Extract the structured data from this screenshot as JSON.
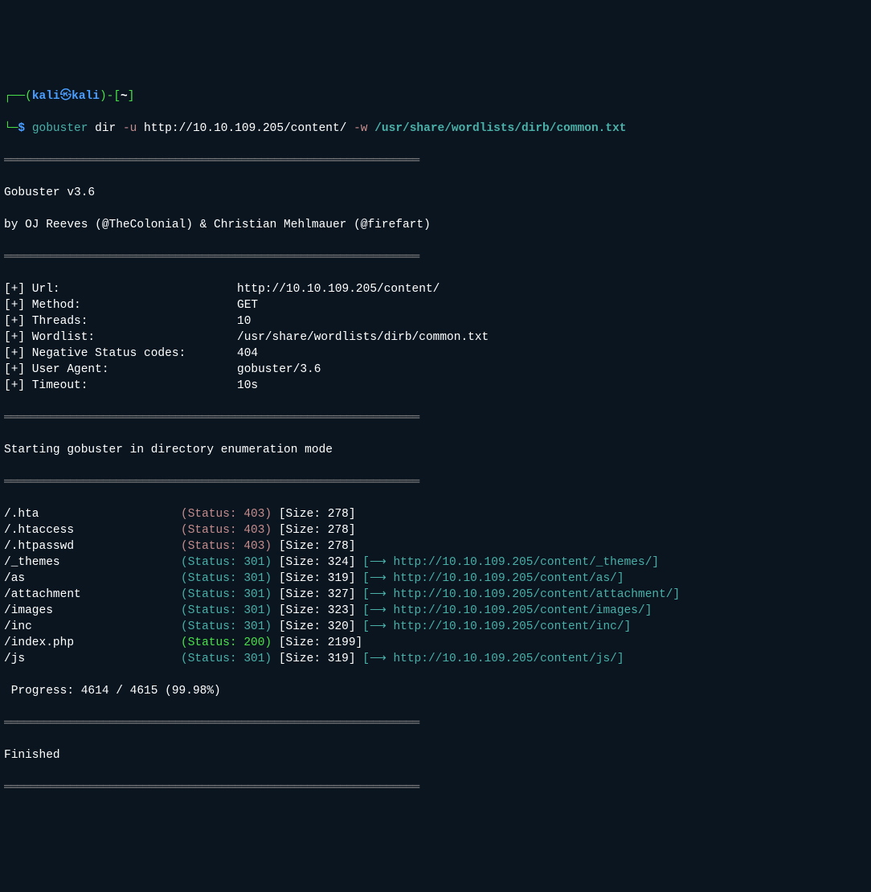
{
  "prompt": {
    "l1_open": "┌──(",
    "user": "kali",
    "skull": "㉿",
    "host": "kali",
    "l1_close": ")-[",
    "tilde": "~",
    "l1_end": "]",
    "l2_open": "└─",
    "dollar": "$ ",
    "cmd": "gobuster",
    "arg1": " dir ",
    "flag1": "-u",
    "url": " http://10.10.109.205/content/ ",
    "flag2": "-w",
    "wordlist": " /usr/share/wordlists/dirb/common.txt"
  },
  "sep": "═══════════════════════════════════════════════════════════════",
  "header": {
    "title": "Gobuster v3.6",
    "byline": "by OJ Reeves (@TheColonial) & Christian Mehlmauer (@firefart)"
  },
  "config": [
    {
      "label": "[+] Url:",
      "value": "http://10.10.109.205/content/"
    },
    {
      "label": "[+] Method:",
      "value": "GET"
    },
    {
      "label": "[+] Threads:",
      "value": "10"
    },
    {
      "label": "[+] Wordlist:",
      "value": "/usr/share/wordlists/dirb/common.txt"
    },
    {
      "label": "[+] Negative Status codes:",
      "value": "404"
    },
    {
      "label": "[+] User Agent:",
      "value": "gobuster/3.6"
    },
    {
      "label": "[+] Timeout:",
      "value": "10s"
    }
  ],
  "mode": "Starting gobuster in directory enumeration mode",
  "results": [
    {
      "path": "/.hta",
      "status": "(Status: 403)",
      "scol": "redgray",
      "size": " [Size: 278]",
      "redirect": ""
    },
    {
      "path": "/.htaccess",
      "status": "(Status: 403)",
      "scol": "redgray",
      "size": " [Size: 278]",
      "redirect": ""
    },
    {
      "path": "/.htpasswd",
      "status": "(Status: 403)",
      "scol": "redgray",
      "size": " [Size: 278]",
      "redirect": ""
    },
    {
      "path": "/_themes",
      "status": "(Status: 301)",
      "scol": "teal",
      "size": " [Size: 324]",
      "redirect": " [⟶ http://10.10.109.205/content/_themes/]"
    },
    {
      "path": "/as",
      "status": "(Status: 301)",
      "scol": "teal",
      "size": " [Size: 319]",
      "redirect": " [⟶ http://10.10.109.205/content/as/]"
    },
    {
      "path": "/attachment",
      "status": "(Status: 301)",
      "scol": "teal",
      "size": " [Size: 327]",
      "redirect": " [⟶ http://10.10.109.205/content/attachment/]"
    },
    {
      "path": "/images",
      "status": "(Status: 301)",
      "scol": "teal",
      "size": " [Size: 323]",
      "redirect": " [⟶ http://10.10.109.205/content/images/]"
    },
    {
      "path": "/inc",
      "status": "(Status: 301)",
      "scol": "teal",
      "size": " [Size: 320]",
      "redirect": " [⟶ http://10.10.109.205/content/inc/]"
    },
    {
      "path": "/index.php",
      "status": "(Status: 200)",
      "scol": "green",
      "size": " [Size: 2199]",
      "redirect": ""
    },
    {
      "path": "/js",
      "status": "(Status: 301)",
      "scol": "teal",
      "size": " [Size: 319]",
      "redirect": " [⟶ http://10.10.109.205/content/js/]"
    }
  ],
  "progress": " Progress: 4614 / 4615 (99.98%)",
  "finished": "Finished"
}
